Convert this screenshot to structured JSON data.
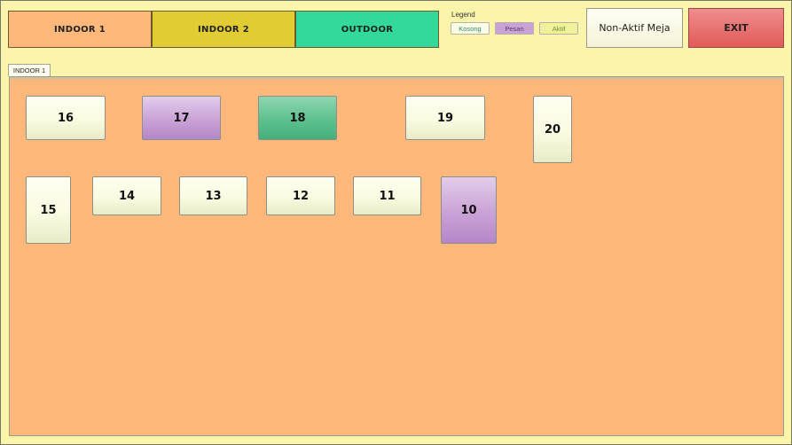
{
  "areas": [
    {
      "label": "INDOOR 1",
      "color": "#ffb87b"
    },
    {
      "label": "INDOOR 2",
      "color": "#e2cc34"
    },
    {
      "label": "OUTDOOR",
      "color": "#33d99a"
    }
  ],
  "legend": {
    "title": "Legend",
    "items": [
      {
        "label": "Kosong",
        "bg": "#fdfde8",
        "fg": "#2a8a6a"
      },
      {
        "label": "Pesan",
        "bg": "#c9a2d6",
        "fg": "#5a3a6a"
      },
      {
        "label": "Aktif",
        "bg": "#eef29a",
        "fg": "#7a8a2a"
      }
    ]
  },
  "buttons": {
    "nonaktif": "Non-Aktif Meja",
    "exit": "EXIT"
  },
  "current_tab": "INDOOR 1",
  "tables": [
    {
      "number": "16",
      "status": "kosong"
    },
    {
      "number": "17",
      "status": "pesan"
    },
    {
      "number": "18",
      "status": "aktif"
    },
    {
      "number": "19",
      "status": "kosong"
    },
    {
      "number": "20",
      "status": "kosong"
    },
    {
      "number": "15",
      "status": "kosong"
    },
    {
      "number": "14",
      "status": "kosong"
    },
    {
      "number": "13",
      "status": "kosong"
    },
    {
      "number": "12",
      "status": "kosong"
    },
    {
      "number": "11",
      "status": "kosong"
    },
    {
      "number": "10",
      "status": "pesan"
    }
  ]
}
